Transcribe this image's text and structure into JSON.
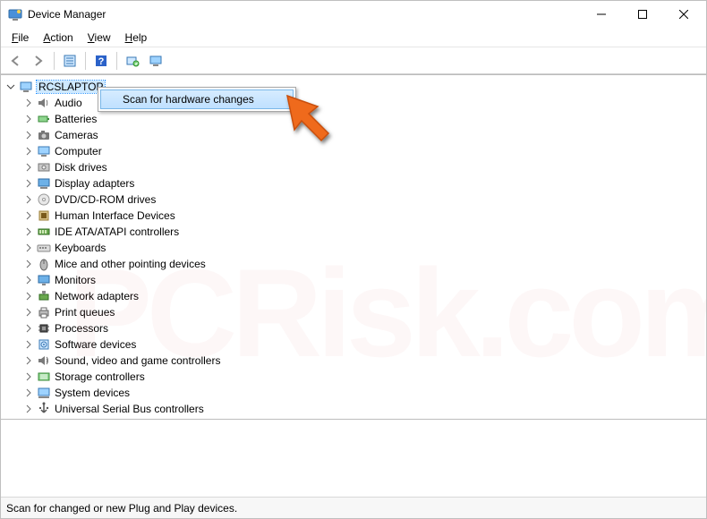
{
  "window": {
    "title": "Device Manager"
  },
  "menus": {
    "file": "File",
    "action": "Action",
    "view": "View",
    "help": "Help"
  },
  "toolbar": {
    "back": "back-icon",
    "forward": "forward-icon",
    "properties": "properties-icon",
    "help": "help-icon",
    "scan": "scan-hardware-icon",
    "update": "update-driver-icon"
  },
  "tree": {
    "root": {
      "label": "RCSLAPTOP"
    },
    "items": [
      {
        "label": "Audio",
        "icon": "speaker-icon"
      },
      {
        "label": "Batteries",
        "icon": "battery-icon"
      },
      {
        "label": "Cameras",
        "icon": "camera-icon"
      },
      {
        "label": "Computer",
        "icon": "computer-icon"
      },
      {
        "label": "Disk drives",
        "icon": "disk-icon"
      },
      {
        "label": "Display adapters",
        "icon": "display-adapter-icon"
      },
      {
        "label": "DVD/CD-ROM drives",
        "icon": "dvd-icon"
      },
      {
        "label": "Human Interface Devices",
        "icon": "hid-icon"
      },
      {
        "label": "IDE ATA/ATAPI controllers",
        "icon": "ide-icon"
      },
      {
        "label": "Keyboards",
        "icon": "keyboard-icon"
      },
      {
        "label": "Mice and other pointing devices",
        "icon": "mouse-icon"
      },
      {
        "label": "Monitors",
        "icon": "monitor-icon"
      },
      {
        "label": "Network adapters",
        "icon": "network-icon"
      },
      {
        "label": "Print queues",
        "icon": "printer-icon"
      },
      {
        "label": "Processors",
        "icon": "cpu-icon"
      },
      {
        "label": "Software devices",
        "icon": "software-icon"
      },
      {
        "label": "Sound, video and game controllers",
        "icon": "sound-icon"
      },
      {
        "label": "Storage controllers",
        "icon": "storage-icon"
      },
      {
        "label": "System devices",
        "icon": "system-icon"
      },
      {
        "label": "Universal Serial Bus controllers",
        "icon": "usb-icon"
      }
    ]
  },
  "context_menu": {
    "scan_label": "Scan for hardware changes"
  },
  "statusbar": {
    "text": "Scan for changed or new Plug and Play devices."
  },
  "watermark": {
    "text": "PCRisk.com"
  }
}
